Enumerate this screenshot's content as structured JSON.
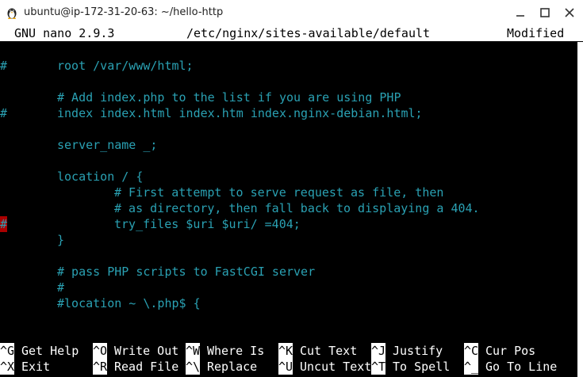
{
  "window": {
    "title": "ubuntu@ip-172-31-20-63: ~/hello-http",
    "icons": {
      "app": "terminal-penguin-icon",
      "minimize": "minimize-icon",
      "maximize": "maximize-icon",
      "close": "close-icon"
    }
  },
  "nano": {
    "app_version": "GNU nano 2.9.3",
    "file_path": "/etc/nginx/sites-available/default",
    "status": "Modified"
  },
  "editor": {
    "lines": [
      {
        "gutter": "",
        "text": ""
      },
      {
        "gutter": "#",
        "text": "root /var/www/html;",
        "indent": 1
      },
      {
        "gutter": "",
        "text": ""
      },
      {
        "gutter": "",
        "text": "# Add index.php to the list if you are using PHP",
        "indent": 1
      },
      {
        "gutter": "#",
        "text": "index index.html index.htm index.nginx-debian.html;",
        "indent": 1
      },
      {
        "gutter": "",
        "text": ""
      },
      {
        "gutter": "",
        "text": "server_name _;",
        "indent": 1
      },
      {
        "gutter": "",
        "text": ""
      },
      {
        "gutter": "",
        "text": "location / {",
        "indent": 1
      },
      {
        "gutter": "",
        "text": "# First attempt to serve request as file, then",
        "indent": 2
      },
      {
        "gutter": "",
        "text": "# as directory, then fall back to displaying a 404.",
        "indent": 2
      },
      {
        "gutter": "#",
        "text": "try_files $uri $uri/ =404;",
        "indent": 2,
        "gutter_highlight": true
      },
      {
        "gutter": "",
        "text": "}",
        "indent": 1
      },
      {
        "gutter": "",
        "text": ""
      },
      {
        "gutter": "",
        "text": "# pass PHP scripts to FastCGI server",
        "indent": 1
      },
      {
        "gutter": "",
        "text": "#",
        "indent": 1
      },
      {
        "gutter": "",
        "text": "#location ~ \\.php$ {",
        "indent": 1
      }
    ]
  },
  "shortcuts": {
    "row1": [
      {
        "key": "^G",
        "label": "Get Help"
      },
      {
        "key": "^O",
        "label": "Write Out"
      },
      {
        "key": "^W",
        "label": "Where Is"
      },
      {
        "key": "^K",
        "label": "Cut Text"
      },
      {
        "key": "^J",
        "label": "Justify"
      },
      {
        "key": "^C",
        "label": "Cur Pos"
      }
    ],
    "row2": [
      {
        "key": "^X",
        "label": "Exit"
      },
      {
        "key": "^R",
        "label": "Read File"
      },
      {
        "key": "^\\",
        "label": "Replace"
      },
      {
        "key": "^U",
        "label": "Uncut Text"
      },
      {
        "key": "^T",
        "label": "To Spell"
      },
      {
        "key": "^_",
        "label": "Go To Line"
      }
    ]
  },
  "colors": {
    "terminal_bg": "#000000",
    "text_cyan": "#2aa1b3",
    "header_bg": "#ffffff",
    "gutter_highlight": "#aa0000"
  }
}
